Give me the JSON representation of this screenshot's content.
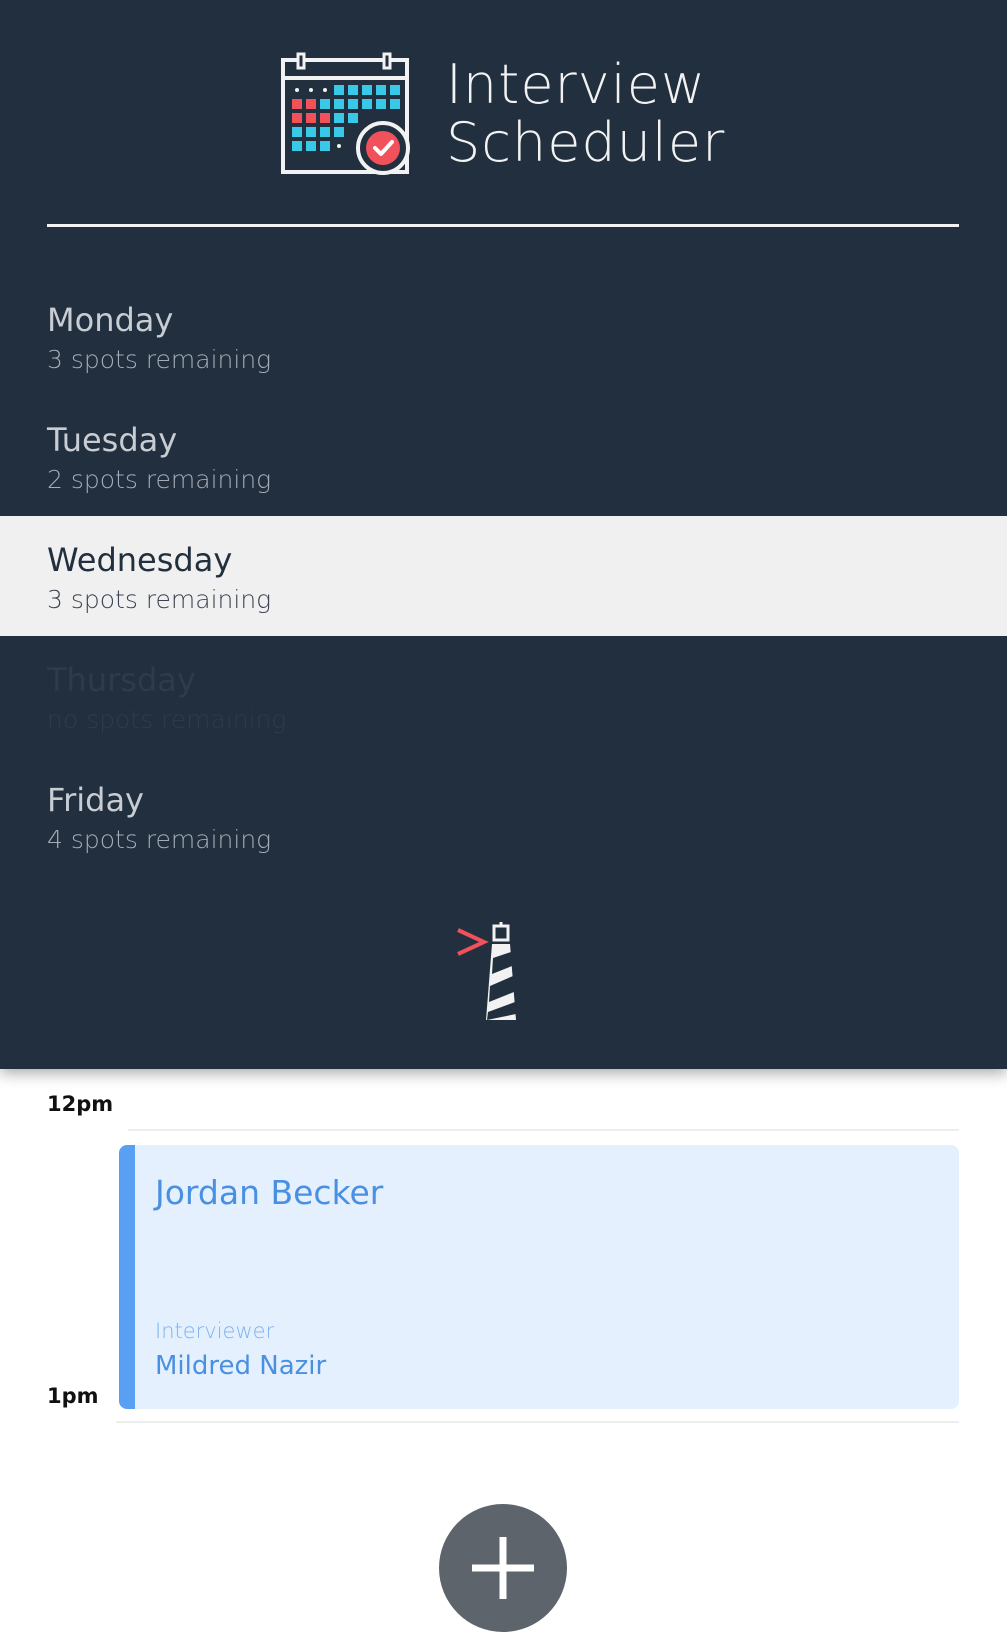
{
  "app": {
    "title_line1": "Interview",
    "title_line2": "Scheduler",
    "logo_icon": "calendar-check-icon",
    "brand_icon": "lighthouse-icon"
  },
  "days": [
    {
      "name": "Monday",
      "spots": "3 spots remaining",
      "state": "normal"
    },
    {
      "name": "Tuesday",
      "spots": "2 spots remaining",
      "state": "normal"
    },
    {
      "name": "Wednesday",
      "spots": "3 spots remaining",
      "state": "selected"
    },
    {
      "name": "Thursday",
      "spots": "no spots remaining",
      "state": "full"
    },
    {
      "name": "Friday",
      "spots": "4 spots remaining",
      "state": "normal"
    }
  ],
  "schedule": {
    "slots": [
      {
        "time": "12pm"
      },
      {
        "time": "1pm"
      }
    ],
    "appointment": {
      "student": "Jordan Becker",
      "interviewer_label": "Interviewer",
      "interviewer_name": "Mildred Nazir"
    },
    "add_icon": "plus-icon"
  },
  "colors": {
    "sidebar_bg": "#222f3e",
    "selected_bg": "#f0f0f0",
    "appointment_bg": "#e4f0fd",
    "appointment_accent": "#5aa0f2",
    "add_button_bg": "#5d646c",
    "logo_red": "#f1515b",
    "logo_cyan": "#39c9e8"
  }
}
